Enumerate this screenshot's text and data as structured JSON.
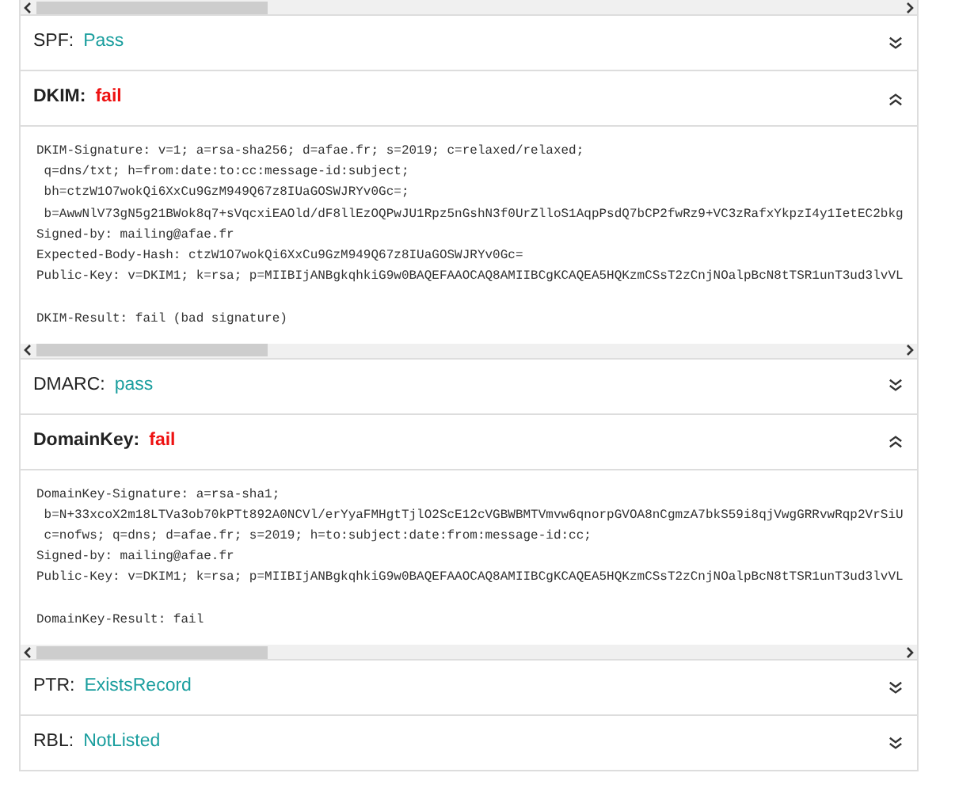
{
  "sections": [
    {
      "label": "SPF:",
      "result": "Pass",
      "color": "#1a9e9e",
      "expanded": false
    },
    {
      "label": "DKIM:",
      "result": "fail",
      "color": "#ee1111",
      "expanded": true,
      "lines": [
        "DKIM-Signature: v=1; a=rsa-sha256; d=afae.fr; s=2019; c=relaxed/relaxed;",
        " q=dns/txt; h=from:date:to:cc:message-id:subject;",
        " bh=ctzW1O7wokQi6XxCu9GzM949Q67z8IUaGOSWJRYv0Gc=;",
        " b=AwwNlV73gN5g21BWok8q7+sVqcxiEAOld/dF8llEzOQPwJU1Rpz5nGshN3f0UrZlloS1AqpPsdQ7bCP2fwRz9+VC3zRafxYkpzI4y1IetEC2bkg",
        "Signed-by: mailing@afae.fr",
        "Expected-Body-Hash: ctzW1O7wokQi6XxCu9GzM949Q67z8IUaGOSWJRYv0Gc=",
        "Public-Key: v=DKIM1; k=rsa; p=MIIBIjANBgkqhkiG9w0BAQEFAAOCAQ8AMIIBCgKCAQEA5HQKzmCSsT2zCnjNOalpBcN8tTSR1unT3ud3lvVL"
      ],
      "result_line": "DKIM-Result: fail (bad signature)"
    },
    {
      "label": "DMARC:",
      "result": "pass",
      "color": "#1a9e9e",
      "expanded": false
    },
    {
      "label": "DomainKey:",
      "result": "fail",
      "color": "#ee1111",
      "expanded": true,
      "lines": [
        "DomainKey-Signature: a=rsa-sha1;",
        " b=N+33xcoX2m18LTVa3ob70kPTt892A0NCVl/erYyaFMHgtTjlO2ScE12cVGBWBMTVmvw6qnorpGVOA8nCgmzA7bkS59i8qjVwgGRRvwRqp2VrSiU",
        " c=nofws; q=dns; d=afae.fr; s=2019; h=to:subject:date:from:message-id:cc;",
        "Signed-by: mailing@afae.fr",
        "Public-Key: v=DKIM1; k=rsa; p=MIIBIjANBgkqhkiG9w0BAQEFAAOCAQ8AMIIBCgKCAQEA5HQKzmCSsT2zCnjNOalpBcN8tTSR1unT3ud3lvVL"
      ],
      "result_line": "DomainKey-Result: fail"
    },
    {
      "label": "PTR:",
      "result": "ExistsRecord",
      "color": "#1a9e9e",
      "expanded": false
    },
    {
      "label": "RBL:",
      "result": "NotListed",
      "color": "#1a9e9e",
      "expanded": false
    }
  ]
}
